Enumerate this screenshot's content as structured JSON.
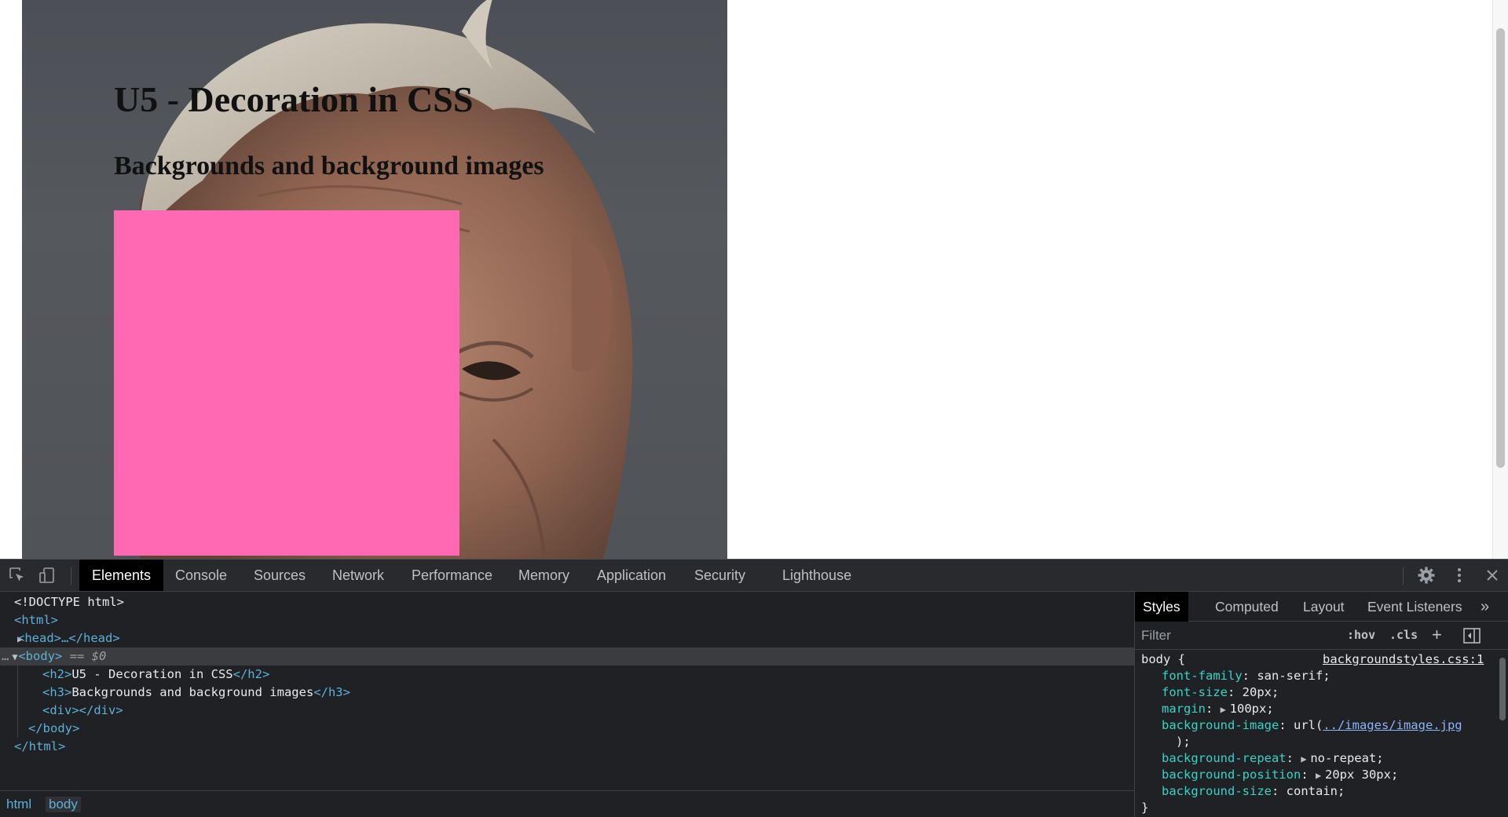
{
  "page": {
    "h2": "U5 - Decoration in CSS",
    "h3": "Backgrounds and background images",
    "div_color": "#ff69b4",
    "background_image": "photo of an older man's face"
  },
  "devtools": {
    "tabs": [
      "Elements",
      "Console",
      "Sources",
      "Network",
      "Performance",
      "Memory",
      "Application",
      "Security",
      "Lighthouse"
    ],
    "active_tab": "Elements",
    "dom": {
      "doctype": "<!DOCTYPE html>",
      "html_open": "<html>",
      "head_collapsed": "<head>…</head>",
      "body_open": "<body>",
      "body_marker": "== $0",
      "h2_open": "<h2>",
      "h2_text": "U5 - Decoration in CSS",
      "h2_close": "</h2>",
      "h3_open": "<h3>",
      "h3_text": "Backgrounds and background images",
      "h3_close": "</h3>",
      "div": "<div></div>",
      "body_close": "</body>",
      "html_close": "</html>"
    },
    "breadcrumbs": [
      "html",
      "body"
    ],
    "styles": {
      "tabs": [
        "Styles",
        "Computed",
        "Layout",
        "Event Listeners"
      ],
      "active_tab": "Styles",
      "more_tabs": "»",
      "filter_placeholder": "Filter",
      "hov": ":hov",
      "cls": ".cls",
      "rule_selector": "body {",
      "rule_source": "backgroundstyles.css:1",
      "rule_close": "}",
      "declarations": [
        {
          "name": "font-family",
          "value": "san-serif;"
        },
        {
          "name": "font-size",
          "value": "20px;"
        },
        {
          "name": "margin",
          "value": "100px;",
          "expandable": true
        },
        {
          "name": "background-image",
          "value_prefix": "url(",
          "link": "../images/image.jpg",
          "value_suffix": ");"
        },
        {
          "name": "background-repeat",
          "value": "no-repeat;",
          "expandable": true
        },
        {
          "name": "background-position",
          "value": "20px 30px;",
          "expandable": true
        },
        {
          "name": "background-size",
          "value": "contain;"
        }
      ]
    }
  }
}
